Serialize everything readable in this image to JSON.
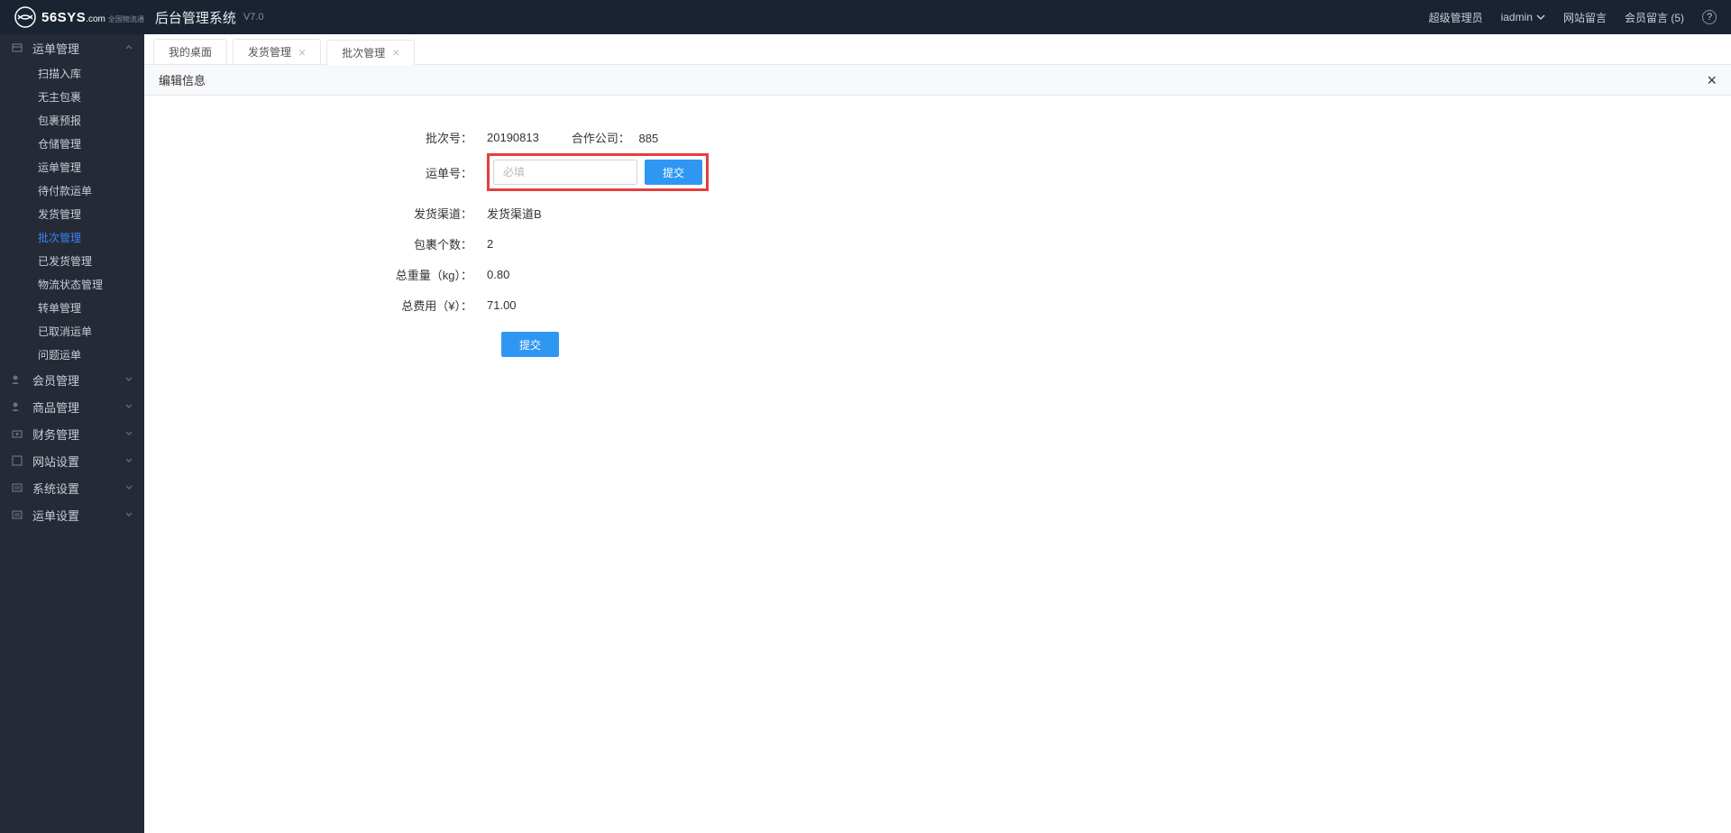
{
  "header": {
    "logo_text": "56SYS",
    "logo_domain": ".com",
    "logo_sub": "全国物流通",
    "system_title": "后台管理系统",
    "version": "V7.0",
    "role": "超级管理员",
    "username": "iadmin",
    "site_msg": "网站留言",
    "member_msg": "会员留言",
    "member_msg_count": "(5)"
  },
  "sidebar": {
    "groups": [
      {
        "label": "运单管理",
        "expanded": true,
        "items": [
          "扫描入库",
          "无主包裹",
          "包裹预报",
          "仓储管理",
          "运单管理",
          "待付款运单",
          "发货管理",
          "批次管理",
          "已发货管理",
          "物流状态管理",
          "转单管理",
          "已取消运单",
          "问题运单"
        ],
        "active_index": 7
      },
      {
        "label": "会员管理",
        "expanded": false
      },
      {
        "label": "商品管理",
        "expanded": false
      },
      {
        "label": "财务管理",
        "expanded": false
      },
      {
        "label": "网站设置",
        "expanded": false
      },
      {
        "label": "系统设置",
        "expanded": false
      },
      {
        "label": "运单设置",
        "expanded": false
      }
    ]
  },
  "tabs": [
    {
      "label": "我的桌面",
      "closable": false
    },
    {
      "label": "发货管理",
      "closable": true
    },
    {
      "label": "批次管理",
      "closable": true,
      "active": true
    }
  ],
  "panel": {
    "title": "编辑信息"
  },
  "form": {
    "batch_no_label": "批次号：",
    "batch_no": "20190813",
    "partner_label": "合作公司：",
    "partner": "885",
    "waybill_label": "运单号：",
    "waybill_placeholder": "必填",
    "waybill_submit": "提交",
    "channel_label": "发货渠道：",
    "channel": "发货渠道B",
    "pkg_count_label": "包裹个数：",
    "pkg_count": "2",
    "weight_label": "总重量（kg）：",
    "weight": "0.80",
    "fee_label": "总费用（¥）：",
    "fee": "71.00",
    "submit": "提交"
  }
}
